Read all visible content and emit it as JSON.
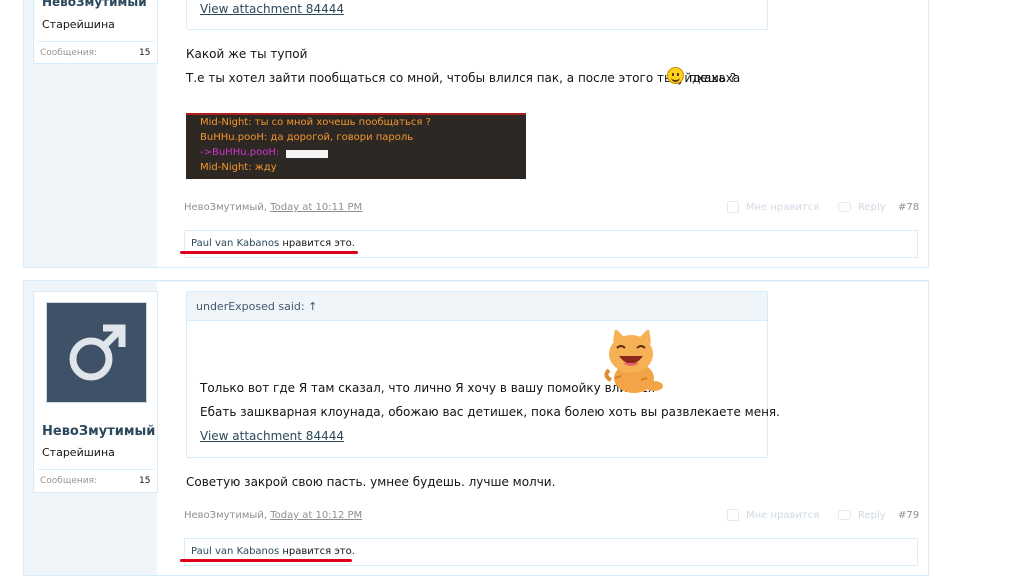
{
  "posts": [
    {
      "author": "НевоЗмутимый",
      "user_title": "Старейшина",
      "stats_label": "Сообщения:",
      "stats_value": "15",
      "attachment_link": "View attachment 84444",
      "lines": [
        "Какой же ты тупой",
        "Т.е ты хотел зайти пообщаться со мной, чтобы влился пак, а после этого ты уйдешь ?",
        "пхахаха"
      ],
      "game_chat": [
        {
          "text": "Mid-Night: ты со мной хочешь пообщаться ?",
          "color": "#f2972e"
        },
        {
          "text": "BuHHu.pooH: да дорогой, говори пароль",
          "color": "#f2972e"
        },
        {
          "text": "->BuHHu.pooH:",
          "color": "#cc33cc"
        },
        {
          "text": "Mid-Night: жду",
          "color": "#f2972e"
        }
      ],
      "meta_author": "НевоЗмутимый,",
      "meta_date": "Today at 10:11 PM",
      "like_label": "Мне нравится",
      "reply_label": "Reply",
      "post_number": "#78",
      "liked_by": "Paul van Kabanos",
      "likes_suffix": " нравится это."
    },
    {
      "author": "НевоЗмутимый",
      "user_title": "Старейшина",
      "stats_label": "Сообщения:",
      "stats_value": "15",
      "quote_author": "underExposed said: ↑",
      "quote_lines": [
        "Только вот где Я там сказал, что лично Я хочу в вашу помойку влиться",
        "Ебать зашкварная клоунада, обожаю вас детишек, пока болею хоть вы развлекаете меня."
      ],
      "attachment_link": "View attachment 84444",
      "lines": [
        "Советую закрой свою пасть. умнее будешь. лучше молчи."
      ],
      "meta_author": "НевоЗмутимый,",
      "meta_date": "Today at 10:12 PM",
      "like_label": "Мне нравится",
      "reply_label": "Reply",
      "post_number": "#79",
      "liked_by": "Paul van Kabanos",
      "likes_suffix": " нравится это."
    }
  ],
  "colors": {
    "highlight_underline": "#e0001b",
    "avatar_bg": "#3e5166",
    "link": "#2b485c"
  }
}
